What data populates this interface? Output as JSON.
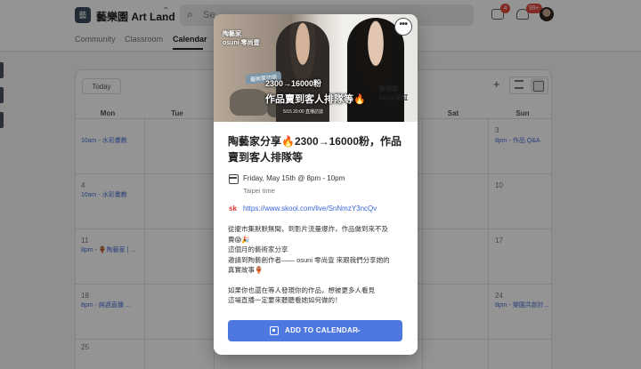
{
  "header": {
    "logo_text": "藝",
    "group_name": "藝樂園 Art Land",
    "search_placeholder": "Se",
    "chat_badge": "4",
    "notification_badge": "99+"
  },
  "tabs": [
    {
      "label": "Community"
    },
    {
      "label": "Classroom"
    },
    {
      "label": "Calendar"
    }
  ],
  "calendar": {
    "today_label": "Today",
    "days_of_week": [
      "Mon",
      "Tue",
      "",
      "",
      "Sat",
      "Sun"
    ],
    "day_numbers": [
      "4",
      "11",
      "18",
      "25",
      "3",
      "10",
      "17",
      "24"
    ],
    "events": [
      "10am - 水彩畫教",
      "10am - 水彩畫教",
      "8pm - 🏺陶藝家 | ...",
      "8pm - 純週直播 ...",
      "8pm - 作品 Q&A",
      "8pm - 樂園共創計..."
    ]
  },
  "event": {
    "cover": {
      "tag_left_1": "陶藝家",
      "tag_left_2": "osuni 零尚壹",
      "pill": "藝術家訪談",
      "headline_1": "2300→16000粉",
      "headline_2": "作品賣到客人排隊等🔥",
      "tag_right_1": "藝樂園",
      "tag_right_2": "Eliya 莉紅",
      "date": "5/15 20:00 直播訪談"
    },
    "more_label": "•••",
    "title": "陶藝家分享🔥2300→16000粉，作品賣到客人排隊等",
    "date_line": "Friday, May 15th @ 8pm - 10pm",
    "timezone": "Taipei time",
    "link_label": "sk",
    "link": "https://www.skool.com/live/SnNmzY3ncQv",
    "description": [
      [
        "從擺市集默默無聞，到影片流量爆炸，作品做到來不及",
        "賣😱🎉",
        "這個月的藝術家分享",
        "邀請到陶藝創作者—— osuni 零尚壹 來跟我們分享她的",
        "真實故事🏺"
      ],
      [
        "如果你也還在等人發現你的作品，想被更多人看見",
        "這場直播一定要來聽聽看她如何做的！"
      ]
    ],
    "add_to_calendar_label": "ADD TO CALENDAR"
  }
}
